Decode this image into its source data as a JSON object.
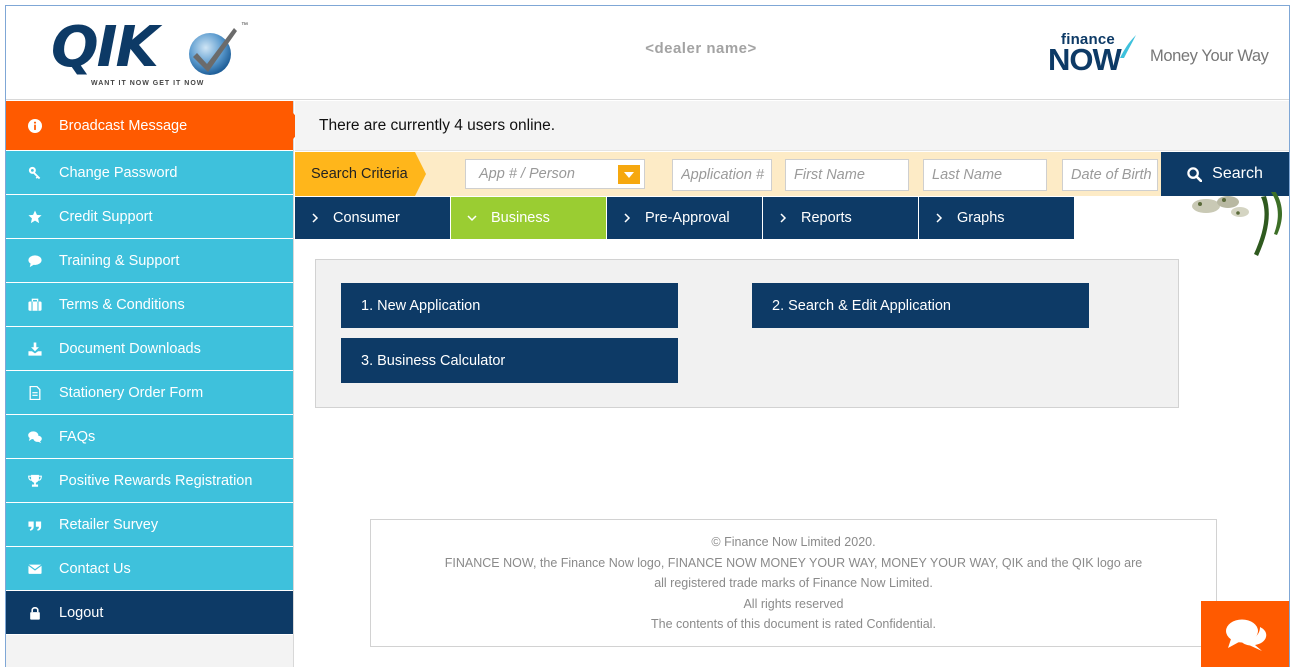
{
  "header": {
    "logo_text": "QIK",
    "logo_tagline": "WANT IT NOW  GET IT NOW",
    "logo_tm": "™",
    "dealer_name": "<dealer name>",
    "brand_small": "finance",
    "brand_big": "NOW",
    "brand_slogan": "Money Your Way"
  },
  "sidebar": {
    "items": [
      {
        "label": "Broadcast Message",
        "icon": "info-icon"
      },
      {
        "label": "Change Password",
        "icon": "key-icon"
      },
      {
        "label": "Credit Support",
        "icon": "star-icon"
      },
      {
        "label": "Training & Support",
        "icon": "speech-bubble-icon"
      },
      {
        "label": "Terms & Conditions",
        "icon": "briefcase-icon"
      },
      {
        "label": "Document Downloads",
        "icon": "download-icon"
      },
      {
        "label": "Stationery Order Form",
        "icon": "document-icon"
      },
      {
        "label": "FAQs",
        "icon": "chat-bubbles-icon"
      },
      {
        "label": "Positive Rewards Registration",
        "icon": "trophy-icon"
      },
      {
        "label": "Retailer Survey",
        "icon": "quote-icon"
      },
      {
        "label": "Contact Us",
        "icon": "envelope-icon"
      },
      {
        "label": "Logout",
        "icon": "lock-icon"
      }
    ]
  },
  "message": "There are currently 4 users online.",
  "search": {
    "criteria_label": "Search Criteria",
    "type_selected": "App # / Person",
    "app_placeholder": "Application #",
    "first_placeholder": "First Name",
    "last_placeholder": "Last Name",
    "dob_placeholder": "Date of Birth",
    "button_label": "Search"
  },
  "tabs": [
    {
      "label": "Consumer",
      "active": false
    },
    {
      "label": "Business",
      "active": true
    },
    {
      "label": "Pre-Approval",
      "active": false
    },
    {
      "label": "Reports",
      "active": false
    },
    {
      "label": "Graphs",
      "active": false
    }
  ],
  "panel": {
    "buttons": [
      "1. New Application",
      "2. Search & Edit Application",
      "3. Business Calculator"
    ]
  },
  "footer": {
    "lines": [
      "© Finance Now Limited 2020.",
      "FINANCE NOW, the Finance Now logo, FINANCE NOW MONEY YOUR WAY, MONEY YOUR WAY, QIK and the QIK logo are",
      "all registered trade marks of Finance Now Limited.",
      "All rights reserved",
      "The contents of this document is rated Confidential."
    ]
  },
  "colors": {
    "navy": "#0d3a66",
    "cyan": "#3ec1dc",
    "orange": "#ff5a00",
    "amber": "#ffb61b",
    "green": "#9acd32"
  }
}
